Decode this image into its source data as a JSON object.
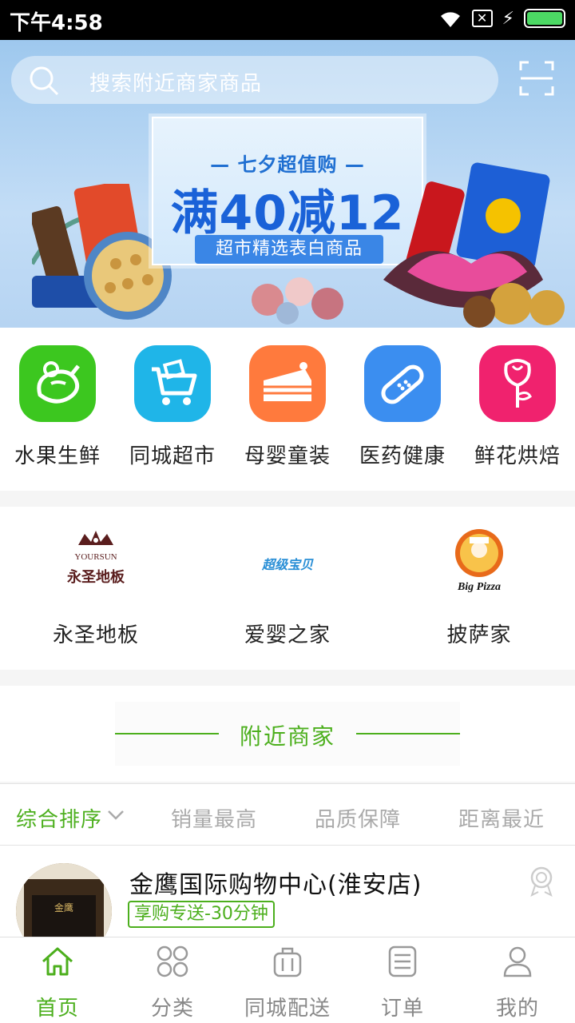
{
  "status_bar": {
    "time": "下午4:58"
  },
  "search": {
    "placeholder": "搜索附近商家商品"
  },
  "banner": {
    "promo_top": "— 七夕超值购 —",
    "promo_main": "满40减12",
    "promo_sub": "超市精选表白商品"
  },
  "categories": [
    {
      "label": "水果生鲜",
      "icon": "eggplant-icon",
      "color": "#3cc71f"
    },
    {
      "label": "同城超市",
      "icon": "shopping-cart-icon",
      "color": "#1fb5e8"
    },
    {
      "label": "母婴童装",
      "icon": "cake-icon",
      "color": "#ff7a3d"
    },
    {
      "label": "医药健康",
      "icon": "bandage-icon",
      "color": "#3b8ef0"
    },
    {
      "label": "鲜花烘焙",
      "icon": "rose-icon",
      "color": "#f0226e"
    }
  ],
  "brands": [
    {
      "label": "永圣地板",
      "logo_text": "YOURSUN",
      "logo_sub": "永圣地板"
    },
    {
      "label": "爱婴之家",
      "logo_text": "超级宝贝"
    },
    {
      "label": "披萨家",
      "logo_text": "Big Pizza"
    }
  ],
  "nearby": {
    "title": "附近商家"
  },
  "sort": {
    "items": [
      "综合排序",
      "销量最高",
      "品质保障",
      "距离最近"
    ],
    "active": 0
  },
  "store": {
    "name": "金鹰国际购物中心(淮安店)",
    "tag": "享购专送-30分钟"
  },
  "tabs": [
    {
      "label": "首页",
      "icon": "home-icon",
      "active": true
    },
    {
      "label": "分类",
      "icon": "category-grid-icon",
      "active": false
    },
    {
      "label": "同城配送",
      "icon": "luggage-icon",
      "active": false
    },
    {
      "label": "订单",
      "icon": "order-list-icon",
      "active": false
    },
    {
      "label": "我的",
      "icon": "user-icon",
      "active": false
    }
  ],
  "colors": {
    "accent": "#4caf1d",
    "muted": "#aaaaaa"
  }
}
